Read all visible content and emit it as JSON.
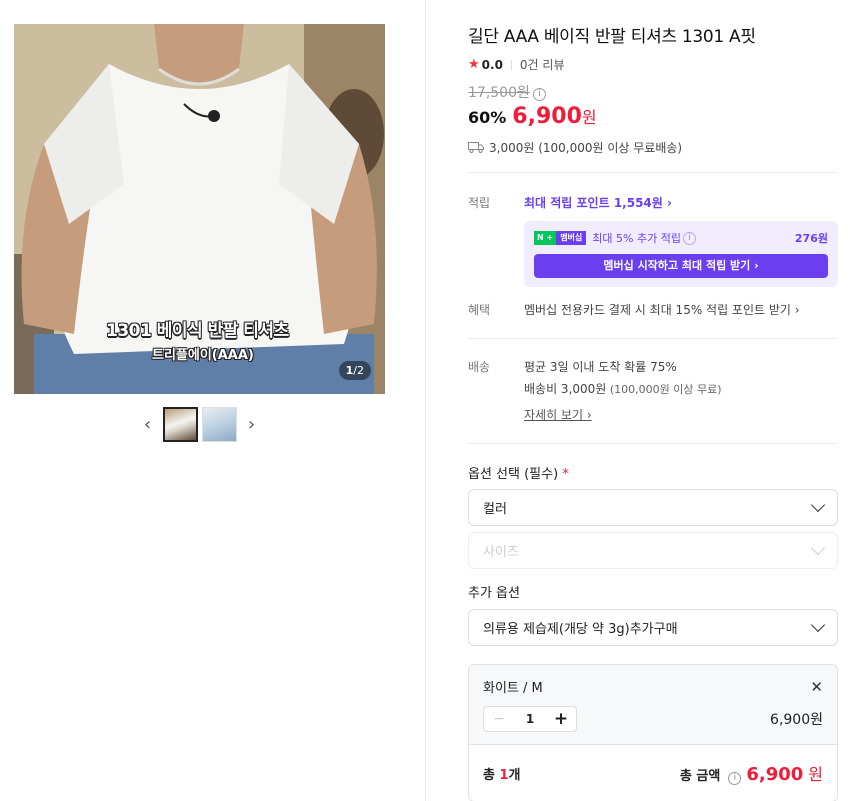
{
  "gallery": {
    "caption_main": "1301 베이식 반팔 티셔츠",
    "caption_sub": "트리플에이(AAA)",
    "counter_current": "1",
    "counter_total": "/2",
    "prev_label": "‹",
    "next_label": "›"
  },
  "product": {
    "title": "길단 AAA 베이직 반팔 티셔츠 1301 A핏",
    "rating_star": "★",
    "rating_score": "0.0",
    "review_count": "0건 리뷰",
    "original_price": "17,500원",
    "info_icon": "i",
    "discount": "60%",
    "price": "6,900",
    "price_unit": "원",
    "shipping": "3,000원 (100,000원 이상 무료배송)"
  },
  "points": {
    "label": "적립",
    "link": "최대 적립 포인트 1,554원 ›",
    "badge_n": "N +",
    "badge_m": "멤버십",
    "extra": "최대 5% 추가 적립",
    "extra_amount": "276원",
    "cta": "멤버십 시작하고 최대 적립 받기 ›"
  },
  "benefit": {
    "label": "혜택",
    "text": "멤버십 전용카드 결제 시 최대 15% 적립 포인트 받기 ›"
  },
  "delivery": {
    "label": "배송",
    "line1": "평균 3일 이내 도착 확률 75%",
    "line2_main": "배송비 3,000원",
    "line2_sub": " (100,000원 이상 무료)",
    "more": "자세히 보기 ›"
  },
  "options": {
    "label": "옵션 선택 (필수)",
    "required_mark": "*",
    "color_select": "컬러",
    "size_select": "사이즈",
    "extra_label": "추가 옵션",
    "extra_select": "의류용 제습제(개당 약 3g)추가구매"
  },
  "selected": {
    "name": "화이트 / M",
    "close": "✕",
    "minus": "−",
    "qty": "1",
    "plus": "+",
    "line_price": "6,900원",
    "total_count_prefix": "총 ",
    "total_count_num": "1",
    "total_count_suffix": "개",
    "total_label": "총 금액",
    "total_price": "6,900",
    "total_unit": "원"
  },
  "colors": {
    "accent_red": "#f01c3a",
    "membership_purple": "#6b3ff0",
    "naver_green": "#03c75a"
  }
}
